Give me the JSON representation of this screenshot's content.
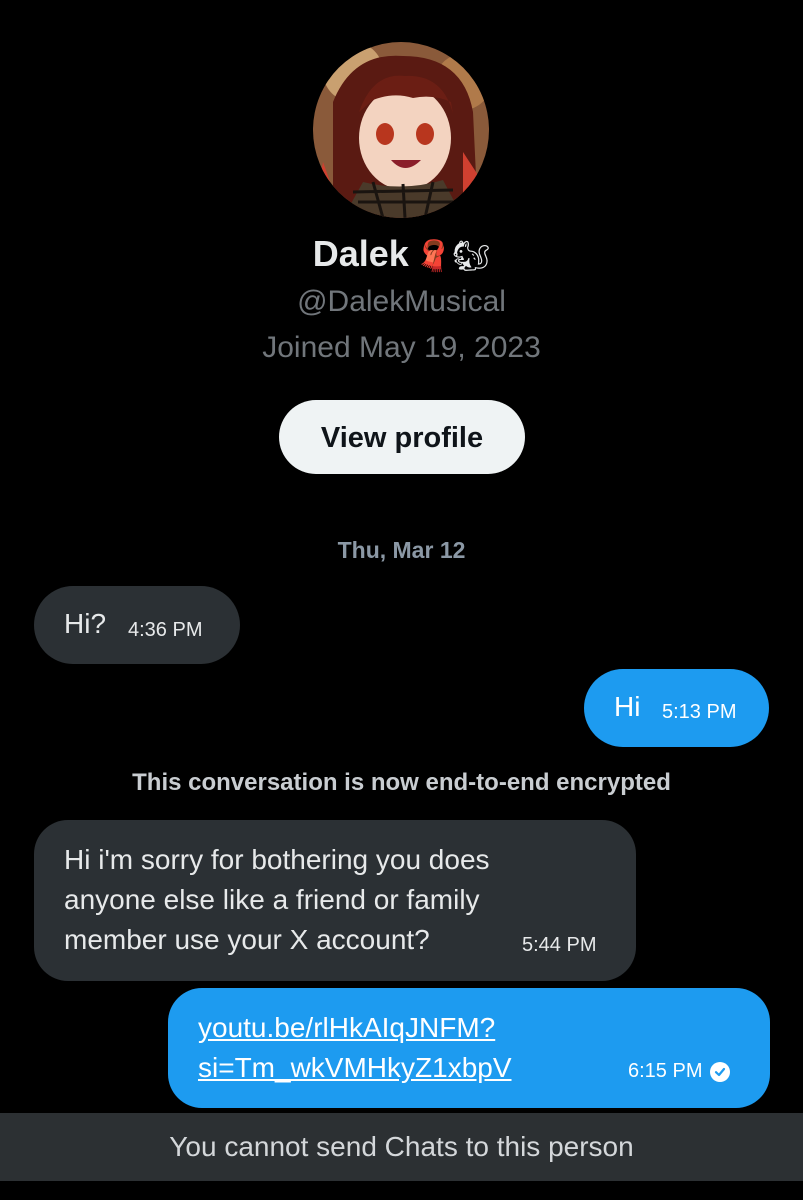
{
  "profile": {
    "display_name": "Dalek",
    "name_emojis": "🧣🐿",
    "handle": "@DalekMusical",
    "joined": "Joined May 19, 2023",
    "view_profile_label": "View profile",
    "avatar_icon": "anime-girl-avatar"
  },
  "conversation": {
    "date_separator": "Thu, Mar 12",
    "encryption_notice": "This conversation is now end-to-end encrypted",
    "messages": [
      {
        "direction": "incoming",
        "text": "Hi?",
        "time": "4:36 PM"
      },
      {
        "direction": "outgoing",
        "text": "Hi",
        "time": "5:13 PM"
      },
      {
        "direction": "incoming",
        "text": "Hi i'm sorry for bothering you does anyone else like a friend or family member use your X account?",
        "time": "5:44 PM"
      },
      {
        "direction": "outgoing",
        "text": "youtu.be/rlHkAIqJNFM?si=Tm_wkVMHkyZ1xbpV",
        "line1": "youtu.be/rlHkAIqJNFM?",
        "line2": "si=Tm_wkVMHkyZ1xbpV",
        "time": "6:15 PM",
        "status_icon": "check-circle-icon"
      }
    ]
  },
  "footer": {
    "notice": "You cannot send Chats to this person"
  },
  "colors": {
    "background": "#000000",
    "incoming_bubble": "#2b3034",
    "outgoing_bubble": "#1d9bf0",
    "secondary_text": "#71767b",
    "button_bg": "#eff3f4"
  }
}
